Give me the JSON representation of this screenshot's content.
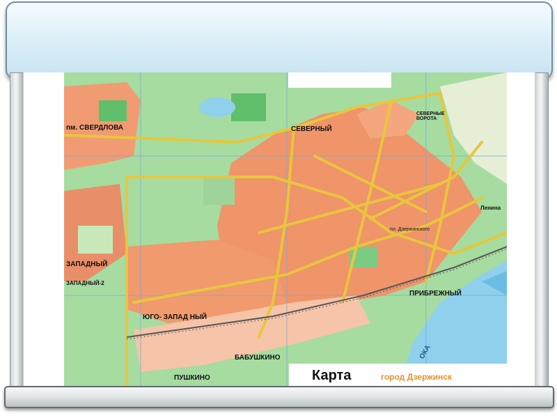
{
  "map": {
    "caption": "Карта",
    "subtitle": "город Дзержинск",
    "labels": {
      "sverdlova": "пм. СВЕРДЛОВА",
      "severny": "СЕВЕРНЫЙ",
      "zapadny": "ЗАПАДНЫЙ",
      "yugo_zapadny": "ЮГО-  ЗАПАД НЫЙ",
      "pribrezhny": "ПРИБРЕЖНЫЙ",
      "babushkino": "БАБУШКИНО",
      "pushkino": "ПУШКИНО",
      "oka": "ОКА",
      "zapadny2": "ЗАПАДНЫЙ-2",
      "severnye_vorota": "СЕВЕРНЫЕ ВОРОТА",
      "lenina": "Ленина",
      "dzerzhinsky": "пл. Дзержинского"
    },
    "colors": {
      "background_green": "#9bd89b",
      "residential_orange": "#f0946a",
      "road_yellow": "#f2d64a",
      "water_blue": "#7fc8e8",
      "park_green": "#5fbf6a",
      "grid_blue": "#7fa9cf"
    }
  }
}
